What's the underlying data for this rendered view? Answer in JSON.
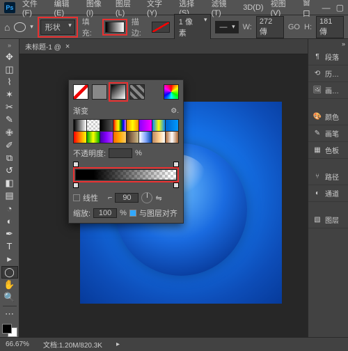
{
  "menu": {
    "items": [
      "文件(F)",
      "编辑(E)",
      "图像(I)",
      "图层(L)",
      "文字(Y)",
      "选择(S)",
      "滤镜(T)",
      "3D(D)",
      "视图(V)",
      "窗口"
    ]
  },
  "options": {
    "shape_mode": "形状",
    "fill_label": "填充:",
    "stroke_label": "描边:",
    "stroke_width": "1 像素",
    "w_label": "W:",
    "w_value": "272 傳",
    "link_label": "GO",
    "h_label": "H:",
    "h_value": "181 傳"
  },
  "doc_tab": {
    "title": "未标题-1 @"
  },
  "right_panels": {
    "items": [
      {
        "icon": "¶",
        "label": "段落"
      },
      {
        "icon": "⟲",
        "label": "历…"
      },
      {
        "icon": "🖼",
        "label": "画…"
      },
      {
        "icon": "🎨",
        "label": "颜色"
      },
      {
        "icon": "✎",
        "label": "画笔"
      },
      {
        "icon": "▦",
        "label": "色板"
      },
      {
        "icon": "⑂",
        "label": "路径"
      },
      {
        "icon": "◐",
        "label": "通道"
      },
      {
        "icon": "▧",
        "label": "图层"
      }
    ]
  },
  "gradient_panel": {
    "title": "渐变",
    "opacity_label": "不透明度:",
    "opacity_unit": "%",
    "linear_label": "线性",
    "angle_value": "90",
    "scale_label": "缩放:",
    "scale_value": "100",
    "scale_unit": "%",
    "align_label": "与图层对齐"
  },
  "status": {
    "zoom": "66.67%",
    "docinfo": "文档:1.20M/820.3K"
  },
  "gradient_presets": [
    "linear-gradient(to right,#000,#fff)",
    "repeating-conic-gradient(#ccc 0 25%,#fff 0 50%) 0/6px 6px",
    "linear-gradient(to right,#000,#555)",
    "linear-gradient(to right,red,orange,yellow,green,blue,violet)",
    "linear-gradient(to right,#f80,#ff0,#f80)",
    "linear-gradient(to right,#80f,#f0f)",
    "linear-gradient(to right,#08f,#ff0,#08f)",
    "linear-gradient(to right,#06c,#09f)",
    "linear-gradient(to right,#f00,#ff0)",
    "linear-gradient(to right,#0a0,#ff0,#0a0)",
    "linear-gradient(to right,#40a,#80f,#a4f)",
    "linear-gradient(to right,#f60,#fa0,#fc6)",
    "linear-gradient(to right,#432,#975,#cb8)",
    "linear-gradient(to right,#fff,#8af,#04a)",
    "linear-gradient(to right,#b86,#fc8,#fff)",
    "linear-gradient(to right,#a63,#fff,#a63)"
  ]
}
